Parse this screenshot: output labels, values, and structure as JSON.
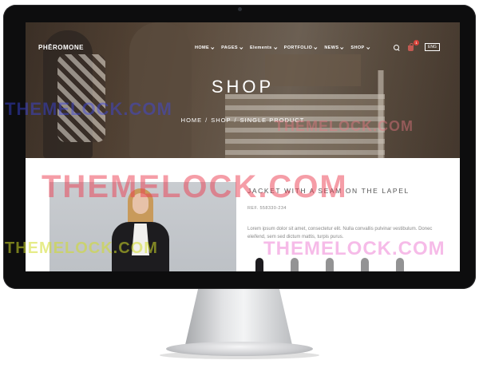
{
  "site": {
    "logo": "PHĒROMONE",
    "nav": [
      {
        "label": "HOME"
      },
      {
        "label": "PAGES"
      },
      {
        "label": "Elements"
      },
      {
        "label": "PORTFOLIO"
      },
      {
        "label": "NEWS"
      },
      {
        "label": "SHOP"
      }
    ],
    "cart_count": "1",
    "language": "ENG"
  },
  "hero": {
    "title": "SHOP",
    "breadcrumb": [
      "HOME",
      "SHOP",
      "SINGLE PRODUCT"
    ],
    "separator": "/"
  },
  "product": {
    "title": "JACKET WITH A SEAM ON THE LAPEL",
    "ref": "REF. 558330-234",
    "description": "Lorem ipsum dolor sit amet, consectetur elit. Nulla convallis pulvinar vestibulum. Donec eleifend, sem sed dictum mattis, turpis purus."
  },
  "watermark": "THEMELOCK.COM",
  "colors": {
    "frame": "#0d0d0e",
    "accent_badge": "#d8433a",
    "text_muted": "#888888"
  },
  "icons": [
    "search-icon",
    "cart-icon"
  ]
}
